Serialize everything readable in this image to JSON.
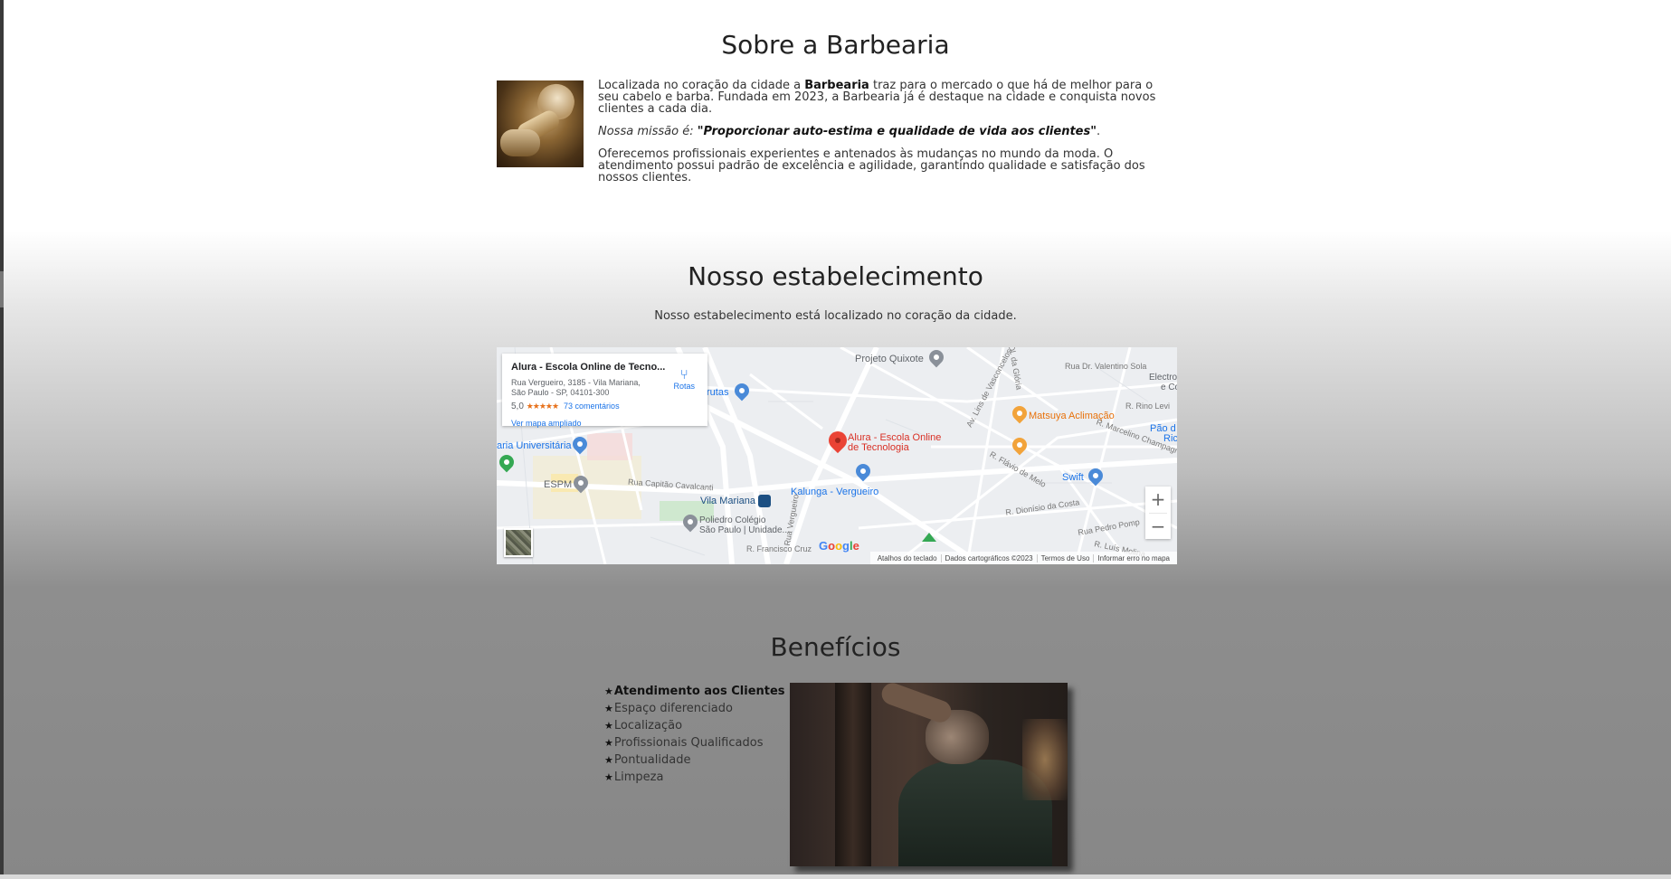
{
  "sobre": {
    "title": "Sobre a Barbearia",
    "p1_before": "Localizada no coração da cidade a ",
    "p1_brand": "Barbearia",
    "p1_after": " traz para o mercado o que há de melhor para o seu cabelo e barba. Fundada em 2023, a Barbearia já é destaque na cidade e conquista novos clientes a cada dia.",
    "missao_label": "Nossa missão é: ",
    "missao_quote": "\"Proporcionar auto-estima e qualidade de vida aos clientes\"",
    "missao_end": ".",
    "p3": "Oferecemos profissionais experientes e antenados às mudanças no mundo da moda. O atendimento possui padrão de excelência e agilidade, garantindo qualidade e satisfação dos nossos clientes."
  },
  "estabelecimento": {
    "title": "Nosso estabelecimento",
    "subtitle": "Nosso estabelecimento está localizado no coração da cidade.",
    "map": {
      "card": {
        "name": "Alura - Escola Online de Tecno...",
        "address": "Rua Vergueiro, 3185 - Vila Mariana, São Paulo - SP, 04101-300",
        "rating": "5,0",
        "stars": "★★★★★",
        "reviews": "73 comentários",
        "big_map_link": "Ver mapa ampliado",
        "directions": "Rotas"
      },
      "labels": {
        "projeto_quixote": "Projeto Quixote",
        "frutas": "rutas",
        "universitaria": "aria Universitária",
        "espm": "ESPM",
        "vila_mariana": "Vila Mariana",
        "poliedro": "Poliedro Colégio",
        "poliedro2": "São Paulo | Unidade...",
        "kalunga": "Kalunga - Vergueiro",
        "alura_pin_1": "Alura - Escola Online",
        "alura_pin_2": "de Tecnologia",
        "matsuya": "Matsuya Aclimação",
        "swift": "Swift",
        "pao_1": "Pão d",
        "pao_2": "Ric",
        "electro_1": "Electro",
        "electro_2": "e Co",
        "rua_capitao": "Rua Capitão Cavalcanti",
        "rua_francisco": "R. Francisco Cruz",
        "rua_vergueiro": "Rua Vergueiro",
        "av_lins": "Av. Lins de Vasconcelos",
        "rua_valentino": "Rua Dr. Valentino Sola",
        "rua_rino": "R. Rino Levi",
        "rua_marcelino": "R. Marcelino Champagnat",
        "rua_flavio": "R. Flávio de Melo",
        "rua_dionisio": "R. Dionísio da Costa",
        "rua_pedro": "Rua Pedro Pomp",
        "rua_luis": "R. Luís Molina",
        "rua_gloria": "Ol. da Glória"
      },
      "google": [
        "G",
        "o",
        "o",
        "g",
        "l",
        "e"
      ],
      "attribution": [
        "Atalhos do teclado",
        "Dados cartográficos ©2023",
        "Termos de Uso",
        "Informar erro no mapa"
      ],
      "zoom_in": "+",
      "zoom_out": "−"
    }
  },
  "beneficios": {
    "title": "Benefícios",
    "star": "★",
    "items": [
      "Atendimento aos Clientes",
      "Espaço diferenciado",
      "Localização",
      "Profissionais Qualificados",
      "Pontualidade",
      "Limpeza"
    ]
  }
}
